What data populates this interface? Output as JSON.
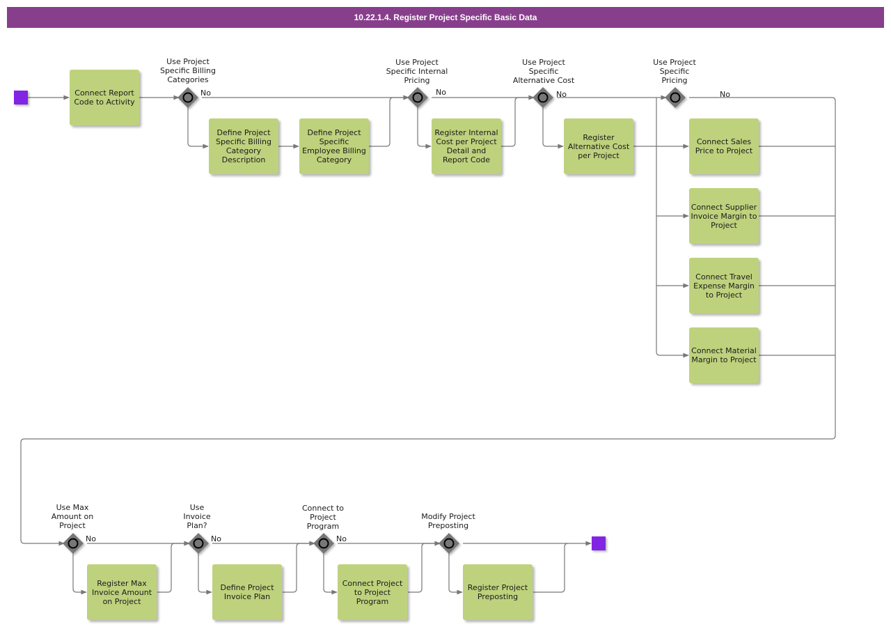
{
  "title": "10.22.1.4. Register Project Specific Basic Data",
  "colors": {
    "header": "#873f8c",
    "task": "#bed27d",
    "event": "#8224e3",
    "gateway": "#777777",
    "line": "#777777"
  },
  "no_label": "No",
  "tasks": [
    {
      "id": "t1",
      "label": "Connect Report Code to Activity"
    },
    {
      "id": "t2",
      "label": "Define Project Specific Billing Category Description"
    },
    {
      "id": "t3",
      "label": "Define Project Specific Employee Billing Category"
    },
    {
      "id": "t4",
      "label": "Register Internal Cost per Project Detail and Report Code"
    },
    {
      "id": "t5",
      "label": "Register Alternative Cost per Project"
    },
    {
      "id": "t6",
      "label": "Connect Sales Price to Project"
    },
    {
      "id": "t7",
      "label": "Connect Supplier Invoice Margin to Project"
    },
    {
      "id": "t8",
      "label": "Connect Travel Expense Margin to Project"
    },
    {
      "id": "t9",
      "label": "Connect Material Margin to Project"
    },
    {
      "id": "t10",
      "label": "Register Max Invoice Amount on Project"
    },
    {
      "id": "t11",
      "label": "Define Project Invoice Plan"
    },
    {
      "id": "t12",
      "label": "Connect Project to Project Program"
    },
    {
      "id": "t13",
      "label": "Register Project Preposting"
    }
  ],
  "gateways": [
    {
      "id": "g1",
      "label": "Use Project\nSpecific Billing\nCategories",
      "no": true
    },
    {
      "id": "g2",
      "label": "Use Project\nSpecific Internal\nPricing",
      "no": true
    },
    {
      "id": "g3",
      "label": "Use Project\nSpecific\nAlternative Cost",
      "no": true
    },
    {
      "id": "g4",
      "label": "Use Project\nSpecific\nPricing",
      "no": true
    },
    {
      "id": "g5",
      "label": "Use Max\nAmount on\nProject",
      "no": true
    },
    {
      "id": "g6",
      "label": "Use\nInvoice\nPlan?",
      "no": true
    },
    {
      "id": "g7",
      "label": "Connect to\nProject\nProgram",
      "no": true
    },
    {
      "id": "g8",
      "label": "Modify Project\nPreposting",
      "no": false
    }
  ],
  "events": [
    {
      "id": "start",
      "type": "start"
    },
    {
      "id": "end",
      "type": "end"
    }
  ]
}
